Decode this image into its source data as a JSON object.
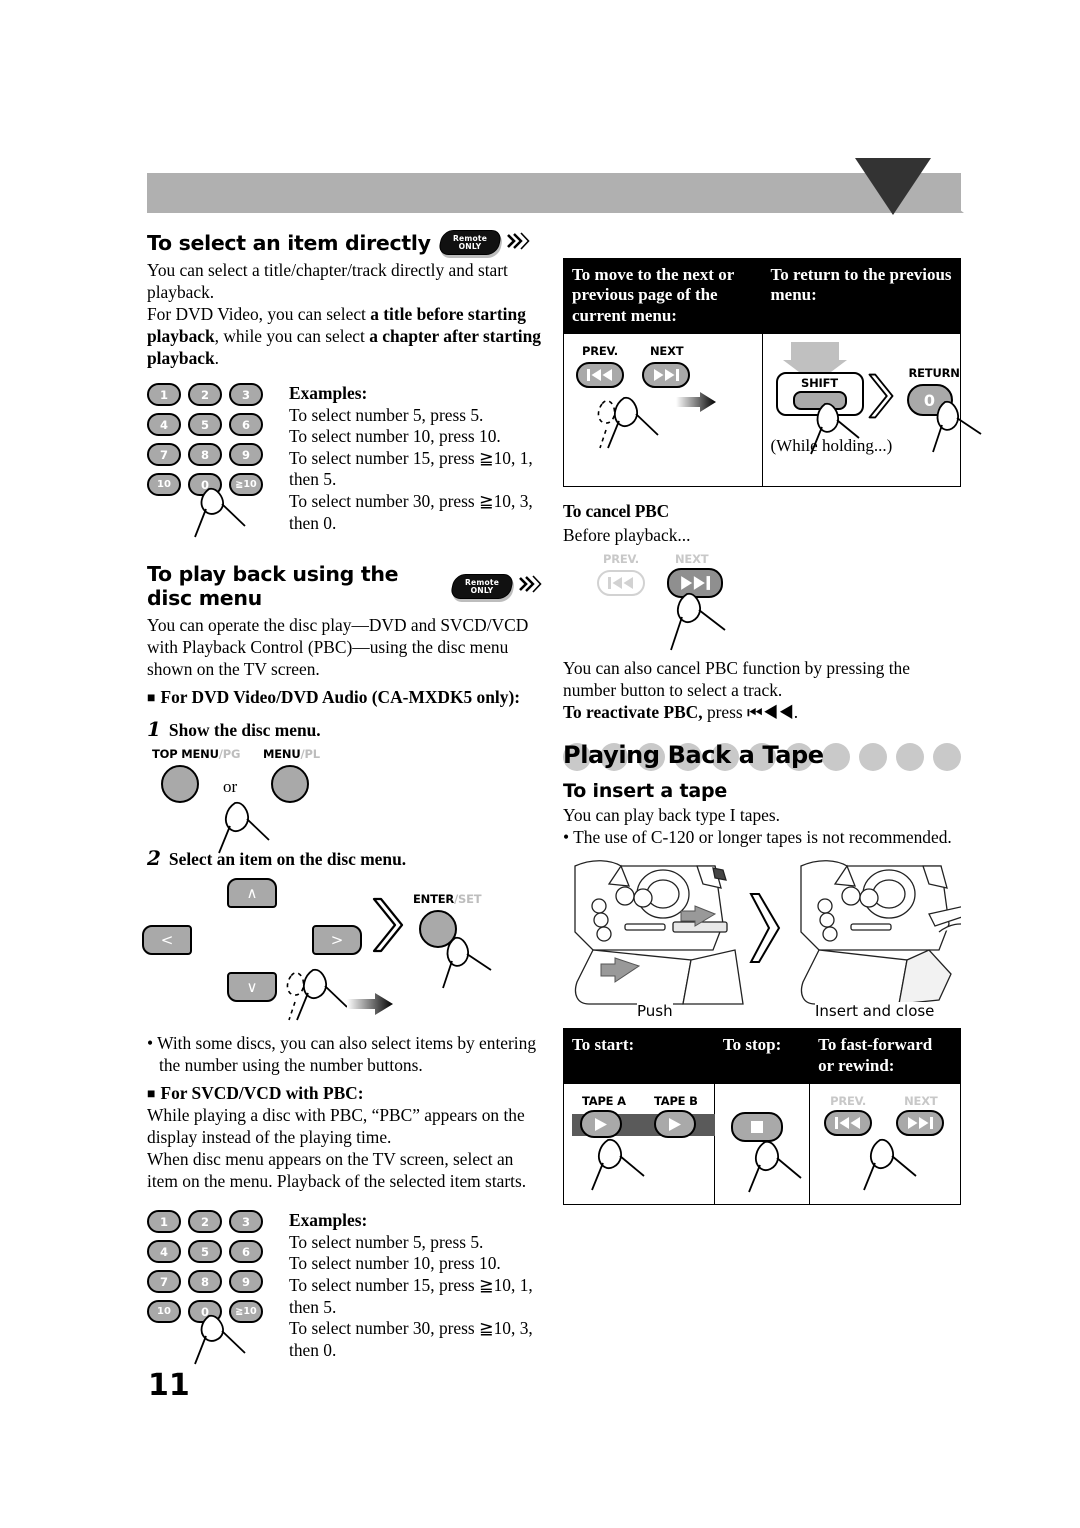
{
  "page": {
    "number": "11"
  },
  "badges": {
    "remote_only_line1": "Remote",
    "remote_only_line2": "ONLY",
    "waves": "⧑)"
  },
  "left": {
    "section1": {
      "title": "To select an item directly",
      "para1": "You can select a title/chapter/track directly and start playback.",
      "para2_pre": "For DVD Video, you can select ",
      "para2_b1": "a title before starting playback",
      "para2_mid": ", while you can select ",
      "para2_b2": "a chapter after starting playback",
      "para2_end": ".",
      "examples_label": "Examples:",
      "examples": [
        "To select number 5, press 5.",
        "To select number 10, press 10.",
        "To select number 15, press ≧10, 1, then 5.",
        "To select number 30, press ≧10, 3, then 0."
      ],
      "keypad": [
        [
          "1",
          "2",
          "3"
        ],
        [
          "4",
          "5",
          "6"
        ],
        [
          "7",
          "8",
          "9"
        ],
        [
          "10",
          "0",
          "≧10"
        ]
      ]
    },
    "section2": {
      "title": "To play back using the disc menu",
      "para1": "You can operate the disc play—DVD and SVCD/VCD with Playback Control (PBC)—using the disc menu shown on the TV screen.",
      "bullet_head1": "For DVD Video/DVD Audio (CA-MXDK5 only):",
      "step1_num": "1",
      "step1_text": "Show the disc menu.",
      "btn_top_menu": "TOP MENU",
      "btn_top_menu_dim": "/PG",
      "or_label": "or",
      "btn_menu": "MENU",
      "btn_menu_dim": "/PL",
      "step2_num": "2",
      "step2_text": "Select an item on the disc menu.",
      "dir_up": "∧",
      "dir_down": "∨",
      "dir_left": "<",
      "dir_right": ">",
      "btn_enter": "ENTER",
      "btn_enter_dim": "/SET",
      "note_bullet": "With some discs, you can also select items by entering the number using the number buttons.",
      "bullet_head2": "For SVCD/VCD with PBC:",
      "para2": "While playing a disc with PBC, “PBC” appears on the display instead of the playing time.",
      "para3": "When disc menu appears on the TV screen, select an item on the menu. Playback of the selected item starts.",
      "examples_label": "Examples:",
      "examples": [
        "To select number 5, press 5.",
        "To select number 10, press 10.",
        "To select number 15, press ≧10, 1, then 5.",
        "To select number 30, press ≧10, 3, then 0."
      ],
      "keypad": [
        [
          "1",
          "2",
          "3"
        ],
        [
          "4",
          "5",
          "6"
        ],
        [
          "7",
          "8",
          "9"
        ],
        [
          "10",
          "0",
          "≧10"
        ]
      ]
    }
  },
  "right": {
    "menu_table": {
      "head_left": "To move to the next or previous page of the current menu:",
      "head_right": "To return to the previous menu:",
      "left_prev_label": "PREV.",
      "left_next_label": "NEXT",
      "right_shift_label": "SHIFT",
      "right_return_label": "RETURN",
      "right_return_key": "0",
      "right_caption": "(While holding...)"
    },
    "cancel_pbc": {
      "title": "To cancel PBC",
      "before": "Before playback...",
      "prev_label": "PREV.",
      "next_label": "NEXT",
      "para": "You can also cancel PBC function by pressing the number button to select a track.",
      "reactivate_b": "To reactivate PBC,",
      "reactivate_rest": " press ⏮◀◀."
    },
    "tape": {
      "heading": "Playing Back a Tape",
      "subheading": "To insert a tape",
      "para1": "You can play back type I tapes.",
      "bullet1": "The use of C-120 or longer tapes is not recommended.",
      "cap_push": "Push",
      "cap_insert": "Insert and close"
    },
    "tape_table": {
      "head_start": "To start:",
      "head_stop": "To stop:",
      "head_ff": "To fast-forward or rewind:",
      "tape_a": "TAPE A",
      "tape_b": "TAPE B",
      "ff_prev": "PREV.",
      "ff_next": "NEXT"
    }
  },
  "colors": {
    "gray_band": "#b0b0b0",
    "dark_tri": "#333333",
    "button_gray": "#a9a9a9",
    "dot_gray": "#c9c9c9"
  }
}
